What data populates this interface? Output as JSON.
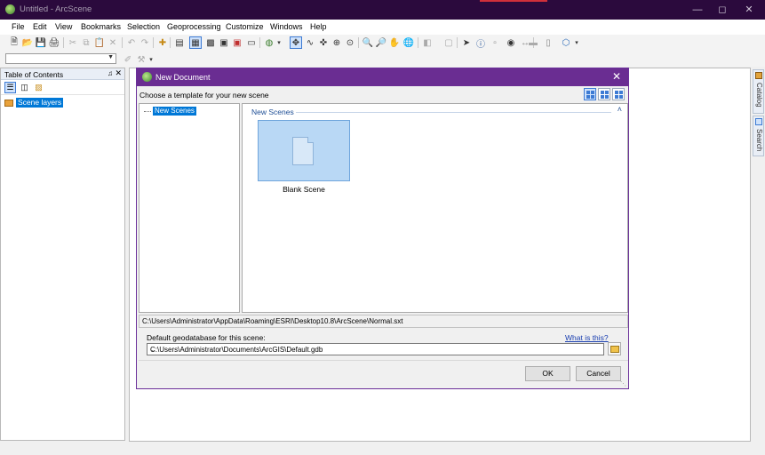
{
  "window": {
    "title": "Untitled - ArcScene",
    "controls": [
      "minimize-icon",
      "maximize-icon",
      "close-icon"
    ]
  },
  "menubar": [
    "File",
    "Edit",
    "View",
    "Bookmarks",
    "Selection",
    "Geoprocessing",
    "Customize",
    "Windows",
    "Help"
  ],
  "toc": {
    "title": "Table of Contents",
    "pin": "pin-icon",
    "close": "close-icon",
    "layer": "Scene layers"
  },
  "sidetabs": [
    "Catalog",
    "Search"
  ],
  "dialog": {
    "title": "New Document",
    "prompt": "Choose a template for your new scene",
    "tree_node": "New Scenes",
    "gallery_header": "New Scenes",
    "tile_label": "Blank Scene",
    "template_path": "C:\\Users\\Administrator\\AppData\\Roaming\\ESRI\\Desktop10.8\\ArcScene\\Normal.sxt",
    "db_label": "Default geodatabase for this scene:",
    "what_link": "What is this?",
    "db_value": "C:\\Users\\Administrator\\Documents\\ArcGIS\\Default.gdb",
    "ok": "OK",
    "cancel": "Cancel"
  },
  "colors": {
    "titlebar": "#2b0a3d",
    "dialog_title": "#6a2d92",
    "selection": "#0078d7",
    "tile": "#b9d8f5"
  }
}
